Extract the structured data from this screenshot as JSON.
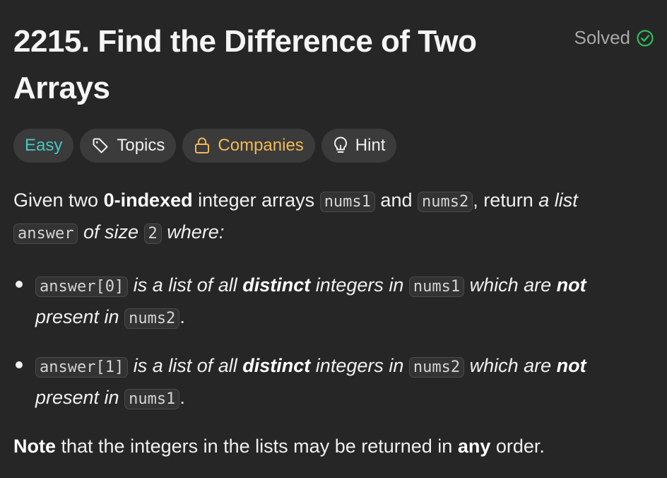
{
  "problem": {
    "title": "2215. Find the Difference of Two Arrays",
    "status": "Solved",
    "tags": {
      "difficulty": "Easy",
      "topics": "Topics",
      "companies": "Companies",
      "hint": "Hint"
    }
  },
  "description": {
    "intro": {
      "t1": "Given two ",
      "b1": "0-indexed",
      "t2": " integer arrays ",
      "c1": "nums1",
      "t3": " and ",
      "c2": "nums2",
      "t4": ", return ",
      "e1": "a list",
      "c3": "answer",
      "e2": " of size ",
      "c4": "2",
      "e3": " where:"
    },
    "bullets": [
      {
        "code_a": "answer[0]",
        "e1": " is a list of all ",
        "b1": "distinct",
        "e2": " integers in ",
        "code_b": "nums1",
        "e3": " which are ",
        "b2": "not",
        "e4": "present in ",
        "code_c": "nums2",
        "end": "."
      },
      {
        "code_a": "answer[1]",
        "e1": " is a list of all ",
        "b1": "distinct",
        "e2": " integers in ",
        "code_b": "nums2",
        "e3": " which are ",
        "b2": "not",
        "e4": "present in ",
        "code_c": "nums1",
        "end": "."
      }
    ],
    "note": {
      "b1": "Note",
      "t1": " that the integers in the lists may be returned in ",
      "b2": "any",
      "t2": " order."
    }
  },
  "colors": {
    "background": "#262626",
    "easy": "#46c6c2",
    "companies": "#f0b956",
    "solved_check": "#2cbb5d"
  },
  "icons": [
    "check-circle-icon",
    "tag-icon",
    "lock-icon",
    "lightbulb-icon"
  ]
}
